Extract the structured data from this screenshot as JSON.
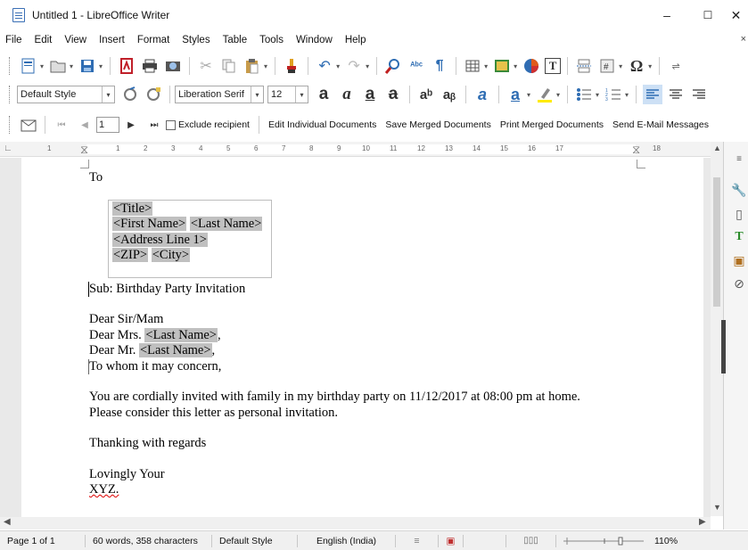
{
  "window": {
    "title": "Untitled 1 - LibreOffice Writer",
    "minimize": "–",
    "maximize": "☐",
    "close": "✕"
  },
  "menu": [
    "File",
    "Edit",
    "View",
    "Insert",
    "Format",
    "Styles",
    "Table",
    "Tools",
    "Window",
    "Help"
  ],
  "menu_close_doc": "×",
  "formatting": {
    "paragraph_style": "Default Style",
    "font_name": "Liberation Serif",
    "font_size": "12"
  },
  "mailmerge": {
    "record_number": "1",
    "exclude_recipient": "Exclude recipient",
    "edit_individual": "Edit Individual Documents",
    "save_merged": "Save Merged Documents",
    "print_merged": "Print Merged Documents",
    "send_email": "Send E-Mail Messages"
  },
  "ruler_ticks": [
    "1",
    "1",
    "2",
    "3",
    "4",
    "5",
    "6",
    "7",
    "8",
    "9",
    "10",
    "11",
    "12",
    "13",
    "14",
    "15",
    "16",
    "17",
    "18"
  ],
  "document": {
    "to": "To",
    "address_line1": "<Title>",
    "address_first_name": "<First Name>",
    "address_last_name": "<Last Name>",
    "address_line3": "<Address Line 1>",
    "address_zip": "<ZIP>",
    "address_city": "<City>",
    "subject": "Sub: Birthday Party Invitation",
    "salutation1": "Dear Sir/Mam",
    "salutation2_prefix": "Dear Mrs. ",
    "salutation2_field": "<Last Name>",
    "salutation2_suffix": ",",
    "salutation3_prefix": "Dear Mr. ",
    "salutation3_field": "<Last Name>",
    "salutation3_suffix": ",",
    "salutation4": "To whom it may concern,",
    "body1": "You are cordially invited with family in my birthday party on 11/12/2017 at 08:00 pm at home.",
    "body2": "Please consider this letter as personal invitation.",
    "thanks": "Thanking with regards",
    "closing": "Lovingly Your",
    "signature": "XYZ."
  },
  "status": {
    "page": "Page 1 of 1",
    "words": "60 words, 358 characters",
    "page_style": "Default Style",
    "language": "English (India)",
    "zoom": "110%"
  }
}
